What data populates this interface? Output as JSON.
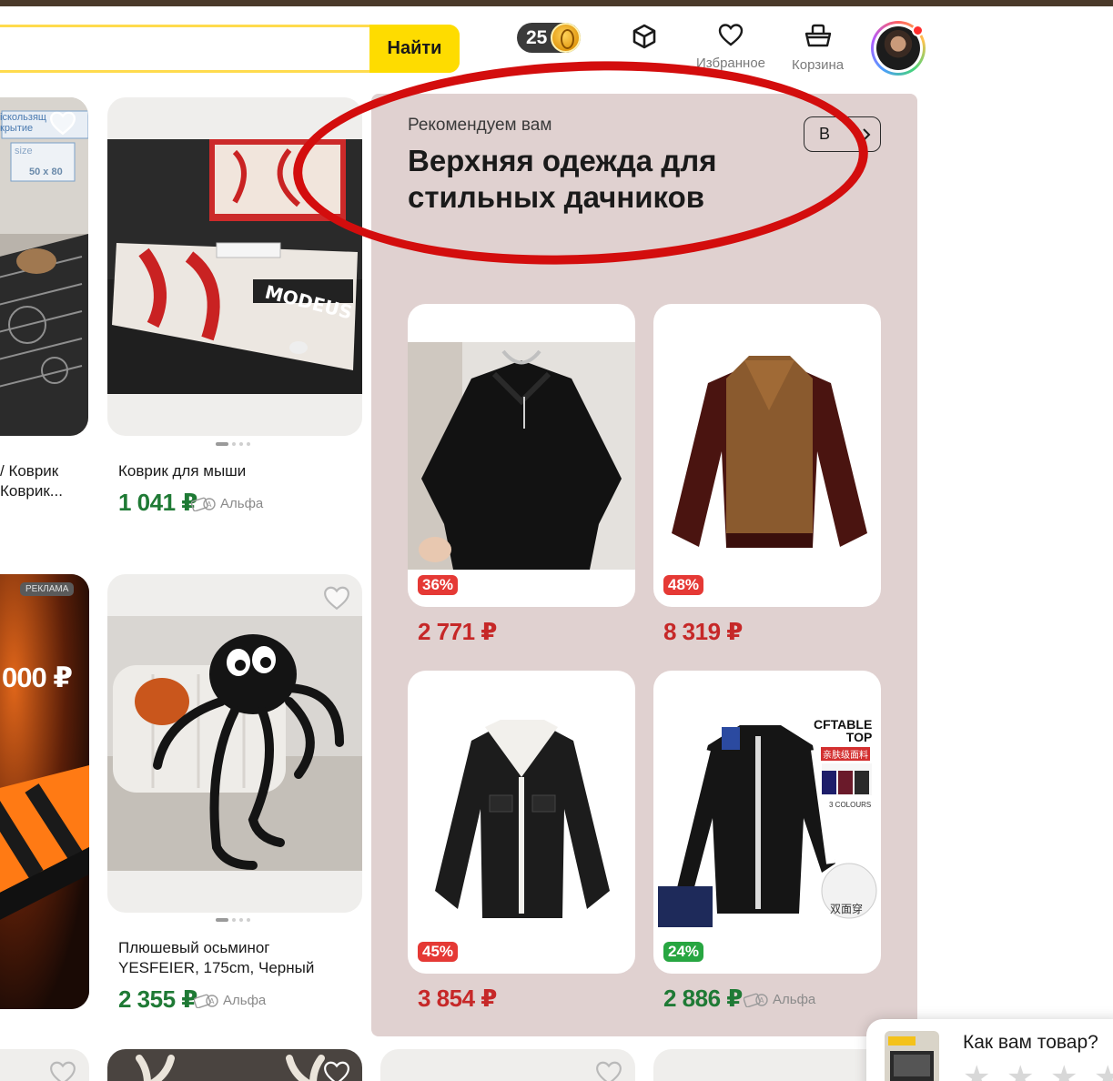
{
  "header": {
    "search_button": "Найти",
    "coins": "25",
    "favorites_label": "Избранное",
    "cart_label": "Корзина"
  },
  "feed": {
    "left_partial_top": {
      "overlay_line1": "іскользящ",
      "overlay_line2": "крытие",
      "size_label": "size",
      "size_value": "50 x 80",
      "title_line1": "/ Коврик",
      "title_line2": "Коврик..."
    },
    "mousepad": {
      "title": "Коврик для мыши",
      "price": "1 041 ₽",
      "bank": "Альфа"
    },
    "left_partial_ad": {
      "badge": "РЕКЛАМА",
      "big_text": "000 ₽"
    },
    "plush": {
      "title_line1": "Плюшевый осьминог",
      "title_line2": "YESFEIER, 175cm, Черный",
      "price": "2 355 ₽",
      "bank": "Альфа"
    }
  },
  "recommend": {
    "subtitle": "Рекомендуем вам",
    "title": "Верхняя одежда для стильных дачников",
    "more_button": "В",
    "items": [
      {
        "discount": "36%",
        "price": "2 771 ₽",
        "discount_color": "#e53935"
      },
      {
        "discount": "48%",
        "price": "8 319 ₽",
        "discount_color": "#e53935"
      },
      {
        "discount": "45%",
        "price": "3 854 ₽",
        "discount_color": "#e53935"
      },
      {
        "discount": "24%",
        "price": "2 886 ₽",
        "bank": "Альфа",
        "discount_color": "#27a641"
      }
    ],
    "brand_text_line1": "CFTABLE",
    "brand_text_line2": "TOP",
    "brand_badge": "亲肤级面料",
    "brand_colours": "3 COLOURS",
    "brand_reversible": "双面穿"
  },
  "feedback": {
    "question": "Как вам товар?"
  },
  "colors": {
    "accent_yellow": "#fedc00",
    "price_green": "#1f7a35",
    "price_red": "#c62828",
    "panel_bg": "#e0d1d0",
    "annotation_red": "#d30d0d"
  }
}
